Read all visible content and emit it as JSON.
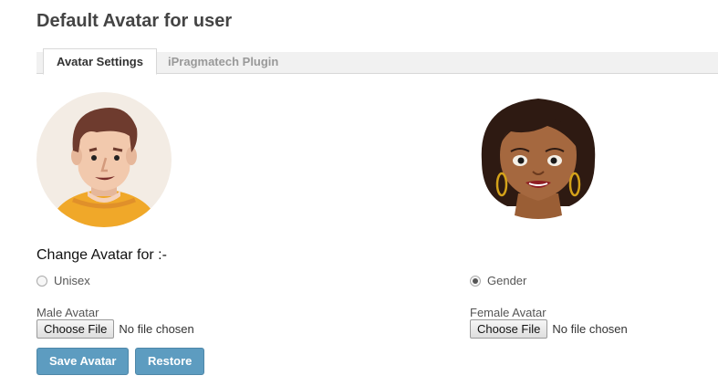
{
  "page": {
    "title": "Default Avatar for user"
  },
  "tabs": [
    {
      "label": "Avatar Settings",
      "active": true
    },
    {
      "label": "iPragmatech Plugin",
      "active": false
    }
  ],
  "avatars": {
    "male_icon": "male-avatar-icon",
    "female_icon": "female-avatar-icon"
  },
  "change_label": "Change Avatar for :-",
  "options": [
    {
      "label": "Unisex",
      "checked": false
    },
    {
      "label": "Gender",
      "checked": true
    }
  ],
  "male_field": {
    "label": "Male Avatar",
    "button": "Choose File",
    "status": "No file chosen"
  },
  "female_field": {
    "label": "Female Avatar",
    "button": "Choose File",
    "status": "No file chosen"
  },
  "actions": {
    "save": "Save Avatar",
    "restore": "Restore"
  },
  "colors": {
    "button": "#5d9cc0",
    "male_shirt": "#f0a829",
    "female_skin": "#a5683f"
  }
}
